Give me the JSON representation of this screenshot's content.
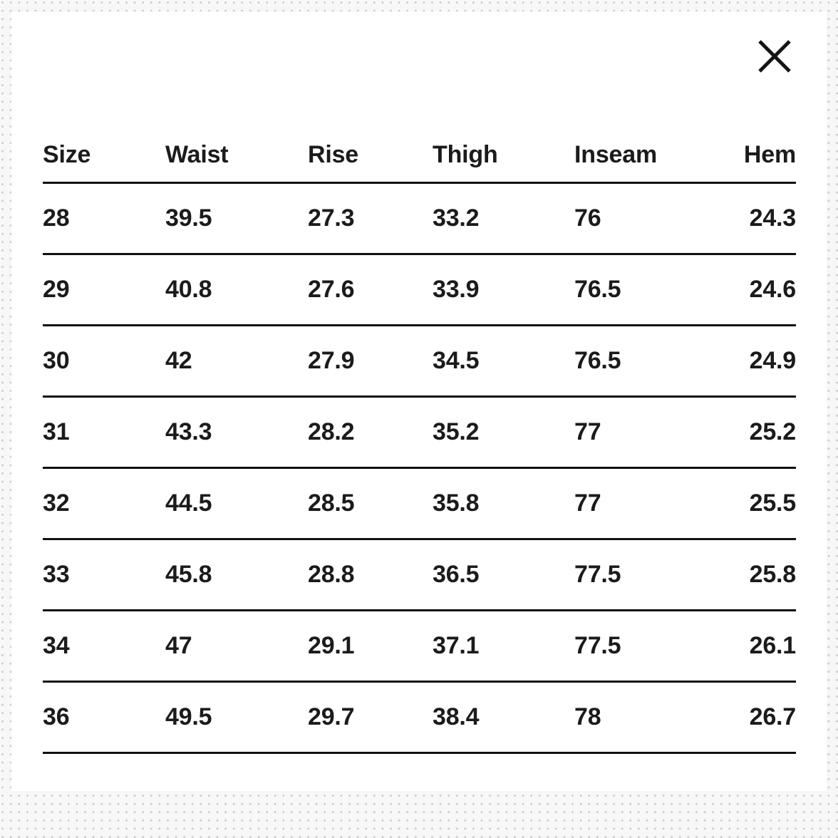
{
  "modal": {
    "close_label": "×",
    "close_icon": "close-x-icon"
  },
  "colors": {
    "text": "#1b1b1b",
    "rule": "#111111",
    "card_background": "#ffffff",
    "page_background": "#f7f7f7",
    "dot": "#c9c9c9"
  },
  "table": {
    "columns": [
      {
        "key": "size",
        "label": "Size",
        "align": "left"
      },
      {
        "key": "waist",
        "label": "Waist",
        "align": "left"
      },
      {
        "key": "rise",
        "label": "Rise",
        "align": "left"
      },
      {
        "key": "thigh",
        "label": "Thigh",
        "align": "left"
      },
      {
        "key": "inseam",
        "label": "Inseam",
        "align": "left"
      },
      {
        "key": "hem",
        "label": "Hem",
        "align": "right"
      }
    ],
    "rows": [
      {
        "size": "28",
        "waist": "39.5",
        "rise": "27.3",
        "thigh": "33.2",
        "inseam": "76",
        "hem": "24.3"
      },
      {
        "size": "29",
        "waist": "40.8",
        "rise": "27.6",
        "thigh": "33.9",
        "inseam": "76.5",
        "hem": "24.6"
      },
      {
        "size": "30",
        "waist": "42",
        "rise": "27.9",
        "thigh": "34.5",
        "inseam": "76.5",
        "hem": "24.9"
      },
      {
        "size": "31",
        "waist": "43.3",
        "rise": "28.2",
        "thigh": "35.2",
        "inseam": "77",
        "hem": "25.2"
      },
      {
        "size": "32",
        "waist": "44.5",
        "rise": "28.5",
        "thigh": "35.8",
        "inseam": "77",
        "hem": "25.5"
      },
      {
        "size": "33",
        "waist": "45.8",
        "rise": "28.8",
        "thigh": "36.5",
        "inseam": "77.5",
        "hem": "25.8"
      },
      {
        "size": "34",
        "waist": "47",
        "rise": "29.1",
        "thigh": "37.1",
        "inseam": "77.5",
        "hem": "26.1"
      },
      {
        "size": "36",
        "waist": "49.5",
        "rise": "29.7",
        "thigh": "38.4",
        "inseam": "78",
        "hem": "26.7"
      }
    ]
  }
}
